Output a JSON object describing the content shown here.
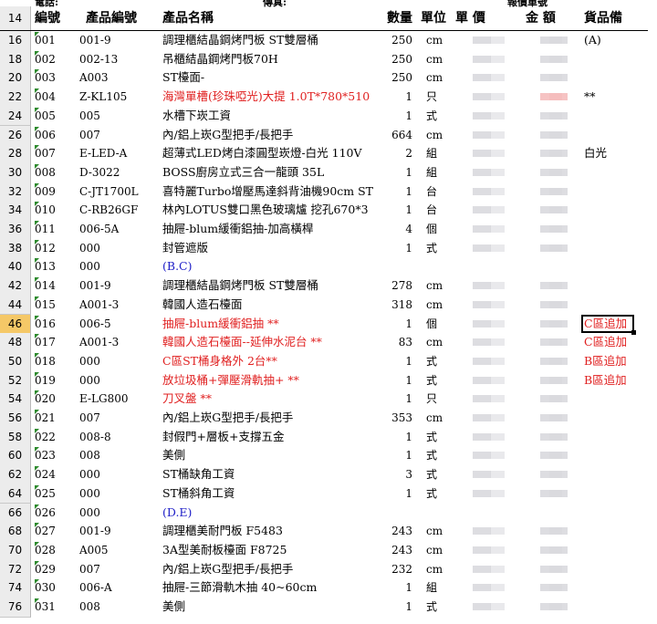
{
  "top_labels": {
    "left": "電話:",
    "middle": "傳真:",
    "right": "報價單號"
  },
  "columns": [
    "編號",
    "產品編號",
    "產品名稱",
    "數量",
    "單位",
    "單 價",
    "金 額",
    "貨品備"
  ],
  "header_row_number": "14",
  "selected_row_number": "46",
  "colors": {
    "red_text": "#e02020",
    "blue_text": "#2020c8",
    "selected_row_header": "#f5c867"
  },
  "rows": [
    {
      "rn": "16",
      "id": "001",
      "code": "001-9",
      "name": "調理櫃結晶鋼烤門板 ST雙層桶",
      "qty": "250",
      "unit": "cm",
      "note": "(A)",
      "color": ""
    },
    {
      "rn": "18",
      "id": "002",
      "code": "002-13",
      "name": "吊櫃結晶鋼烤門板70H",
      "qty": "250",
      "unit": "cm",
      "note": "",
      "color": ""
    },
    {
      "rn": "20",
      "id": "003",
      "code": "A003",
      "name": "ST檯面-",
      "qty": "250",
      "unit": "cm",
      "note": "",
      "color": ""
    },
    {
      "rn": "22",
      "id": "004",
      "code": "Z-KL105",
      "name": "海灣單槽(珍珠啞光)大提 1.0T*780*510",
      "qty": "1",
      "unit": "只",
      "note": "**",
      "color": "red"
    },
    {
      "rn": "24",
      "id": "005",
      "code": "005",
      "name": "水槽下崁工資",
      "qty": "1",
      "unit": "式",
      "note": "",
      "color": ""
    },
    {
      "rn": "26",
      "id": "006",
      "code": "007",
      "name": "內/鋁上崁G型把手/長把手",
      "qty": "664",
      "unit": "cm",
      "note": "",
      "color": ""
    },
    {
      "rn": "28",
      "id": "007",
      "code": "E-LED-A",
      "name": "超薄式LED烤白漆圓型崁燈-白光 110V",
      "qty": "2",
      "unit": "組",
      "note": "白光",
      "color": ""
    },
    {
      "rn": "30",
      "id": "008",
      "code": "D-3022",
      "name": "BOSS廚房立式三合一龍頭 35L",
      "qty": "1",
      "unit": "組",
      "note": "",
      "color": ""
    },
    {
      "rn": "32",
      "id": "009",
      "code": "C-JT1700L",
      "name": "喜特麗Turbo增壓馬達斜背油機90cm ST",
      "qty": "1",
      "unit": "台",
      "note": "",
      "color": ""
    },
    {
      "rn": "34",
      "id": "010",
      "code": "C-RB26GF",
      "name": "林內LOTUS雙口黑色玻璃爐 挖孔670*3",
      "qty": "1",
      "unit": "台",
      "note": "",
      "color": ""
    },
    {
      "rn": "36",
      "id": "011",
      "code": "006-5A",
      "name": "抽屜-blum緩衝鋁抽-加高橫桿",
      "qty": "4",
      "unit": "個",
      "note": "",
      "color": ""
    },
    {
      "rn": "38",
      "id": "012",
      "code": "000",
      "name": "封管遮版",
      "qty": "1",
      "unit": "式",
      "note": "",
      "color": ""
    },
    {
      "rn": "40",
      "id": "013",
      "code": "000",
      "name": "(B.C)",
      "qty": "",
      "unit": "",
      "note": "",
      "color": "blue"
    },
    {
      "rn": "42",
      "id": "014",
      "code": "001-9",
      "name": "調理櫃結晶鋼烤門板 ST雙層桶",
      "qty": "278",
      "unit": "cm",
      "note": "",
      "color": ""
    },
    {
      "rn": "44",
      "id": "015",
      "code": "A001-3",
      "name": "韓國人造石檯面",
      "qty": "318",
      "unit": "cm",
      "note": "",
      "color": ""
    },
    {
      "rn": "46",
      "id": "016",
      "code": "006-5",
      "name": "抽屜-blum緩衝鋁抽 **",
      "qty": "1",
      "unit": "個",
      "note": "C區追加",
      "color": "red"
    },
    {
      "rn": "48",
      "id": "017",
      "code": "A001-3",
      "name": "韓國人造石檯面--延伸水泥台 **",
      "qty": "83",
      "unit": "cm",
      "note": "C區追加",
      "color": "red"
    },
    {
      "rn": "50",
      "id": "018",
      "code": "000",
      "name": "C區ST桶身格外 2台**",
      "qty": "1",
      "unit": "式",
      "note": "B區追加",
      "color": "red"
    },
    {
      "rn": "52",
      "id": "019",
      "code": "000",
      "name": "放垃圾桶+彈壓滑軌抽+ **",
      "qty": "1",
      "unit": "式",
      "note": "B區追加",
      "color": "red"
    },
    {
      "rn": "54",
      "id": "020",
      "code": "E-LG800",
      "name": "刀叉盤 **",
      "qty": "1",
      "unit": "只",
      "note": "",
      "color": "red"
    },
    {
      "rn": "56",
      "id": "021",
      "code": "007",
      "name": "內/鋁上崁G型把手/長把手",
      "qty": "353",
      "unit": "cm",
      "note": "",
      "color": ""
    },
    {
      "rn": "58",
      "id": "022",
      "code": "008-8",
      "name": "封假門+層板+支撐五金",
      "qty": "1",
      "unit": "式",
      "note": "",
      "color": ""
    },
    {
      "rn": "60",
      "id": "023",
      "code": "008",
      "name": "美側",
      "qty": "1",
      "unit": "式",
      "note": "",
      "color": ""
    },
    {
      "rn": "62",
      "id": "024",
      "code": "000",
      "name": "ST桶缺角工資",
      "qty": "3",
      "unit": "式",
      "note": "",
      "color": ""
    },
    {
      "rn": "64",
      "id": "025",
      "code": "000",
      "name": "ST桶斜角工資",
      "qty": "1",
      "unit": "式",
      "note": "",
      "color": ""
    },
    {
      "rn": "66",
      "id": "026",
      "code": "000",
      "name": "(D.E)",
      "qty": "",
      "unit": "",
      "note": "",
      "color": "blue"
    },
    {
      "rn": "68",
      "id": "027",
      "code": "001-9",
      "name": "調理櫃美耐門板 F5483",
      "qty": "243",
      "unit": "cm",
      "note": "",
      "color": ""
    },
    {
      "rn": "70",
      "id": "028",
      "code": "A005",
      "name": "3A型美耐板檯面 F8725",
      "qty": "243",
      "unit": "cm",
      "note": "",
      "color": ""
    },
    {
      "rn": "72",
      "id": "029",
      "code": "007",
      "name": "內/鋁上崁G型把手/長把手",
      "qty": "232",
      "unit": "cm",
      "note": "",
      "color": ""
    },
    {
      "rn": "74",
      "id": "030",
      "code": "006-A",
      "name": "抽屜-三節滑軌木抽 40~60cm",
      "qty": "1",
      "unit": "組",
      "note": "",
      "color": ""
    },
    {
      "rn": "76",
      "id": "031",
      "code": "008",
      "name": "美側",
      "qty": "1",
      "unit": "式",
      "note": "",
      "color": ""
    }
  ]
}
